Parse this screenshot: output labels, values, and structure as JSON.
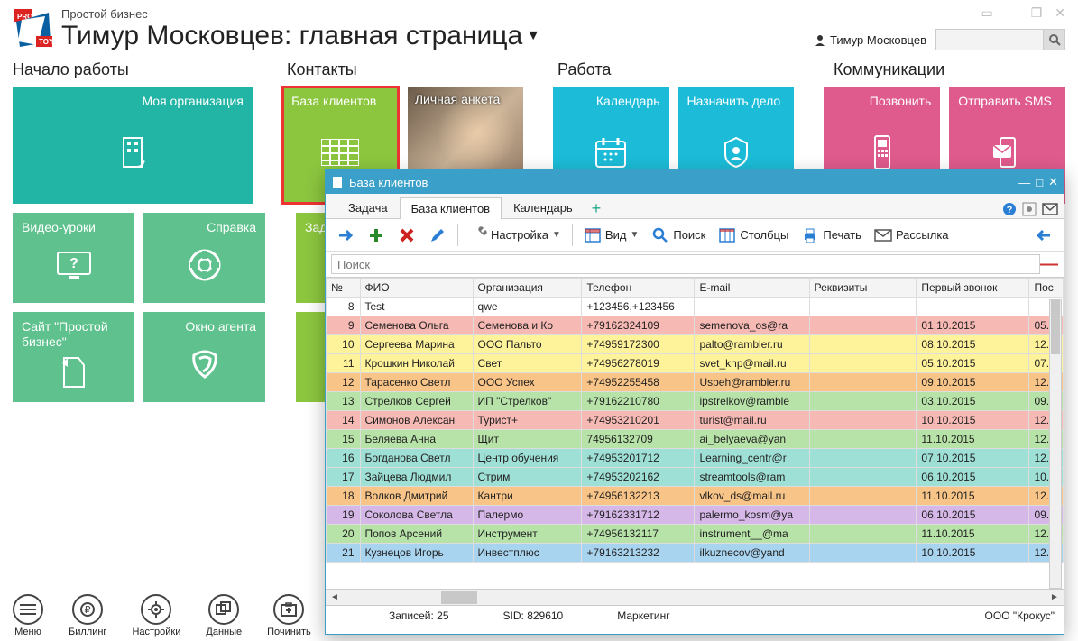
{
  "app": {
    "name": "Простой бизнес",
    "title": "Тимур Московцев: главная страница"
  },
  "user": {
    "name": "Тимур Московцев"
  },
  "search_placeholder": "",
  "sections": {
    "s1": "Начало работы",
    "s2": "Контакты",
    "s3": "Работа",
    "s4": "Коммуникации"
  },
  "tiles": {
    "my_org": "Моя организация",
    "baza": "База клиентов",
    "anketa": "Личная анкета",
    "calendar": "Календарь",
    "assign": "Назначить дело",
    "call": "Позвонить",
    "sms": "Отправить SMS",
    "video": "Видео-уроки",
    "help": "Справка",
    "zad": "Зад",
    "site": "Сайт \"Простой бизнес\"",
    "agent": "Окно агента"
  },
  "bottom": {
    "menu": "Меню",
    "billing": "Биллинг",
    "settings": "Настройки",
    "data": "Данные",
    "fix": "Починить"
  },
  "dbwin": {
    "title": "База клиентов",
    "tabs": {
      "task": "Задача",
      "baza": "База клиентов",
      "cal": "Календарь"
    },
    "toolbar": {
      "settings": "Настройка",
      "view": "Вид",
      "search": "Поиск",
      "columns": "Столбцы",
      "print": "Печать",
      "mail": "Рассылка"
    },
    "search_placeholder": "Поиск",
    "columns": {
      "num": "№",
      "fio": "ФИО",
      "org": "Организация",
      "tel": "Телефон",
      "email": "E-mail",
      "req": "Реквизиты",
      "first": "Первый звонок",
      "pos": "Пос"
    },
    "rows": [
      {
        "n": "8",
        "fio": "Test",
        "org": "qwe",
        "tel": "+123456,+123456",
        "email": "",
        "req": "",
        "first": "",
        "pos": "",
        "cls": "row-white"
      },
      {
        "n": "9",
        "fio": "Семенова Ольга",
        "org": "Семенова и Ко",
        "tel": "+79162324109",
        "email": "semenova_os@ra",
        "req": "",
        "first": "01.10.2015",
        "pos": "05.",
        "cls": "row-pink"
      },
      {
        "n": "10",
        "fio": "Сергеева Марина",
        "org": "ООО Пальто",
        "tel": "+74959172300",
        "email": "palto@rambler.ru",
        "req": "",
        "first": "08.10.2015",
        "pos": "12.",
        "cls": "row-yellow"
      },
      {
        "n": "11",
        "fio": "Крошкин Николай",
        "org": "Свет",
        "tel": "+74956278019",
        "email": "svet_knp@mail.ru",
        "req": "",
        "first": "05.10.2015",
        "pos": "07.",
        "cls": "row-yellow"
      },
      {
        "n": "12",
        "fio": "Тарасенко Светл",
        "org": "ООО Успех",
        "tel": "+74952255458",
        "email": "Uspeh@rambler.ru",
        "req": "",
        "first": "09.10.2015",
        "pos": "12.",
        "cls": "row-orange"
      },
      {
        "n": "13",
        "fio": "Стрелков Сергей",
        "org": "ИП \"Стрелков\"",
        "tel": "+79162210780",
        "email": "ipstrelkov@ramble",
        "req": "",
        "first": "03.10.2015",
        "pos": "09.",
        "cls": "row-green"
      },
      {
        "n": "14",
        "fio": "Симонов Алексан",
        "org": "Турист+",
        "tel": "+74953210201",
        "email": "turist@mail.ru",
        "req": "",
        "first": "10.10.2015",
        "pos": "12.",
        "cls": "row-pink"
      },
      {
        "n": "15",
        "fio": "Беляева Анна",
        "org": "Щит",
        "tel": "74956132709",
        "email": "ai_belyaeva@yan",
        "req": "",
        "first": "11.10.2015",
        "pos": "12.",
        "cls": "row-green"
      },
      {
        "n": "16",
        "fio": "Богданова Светл",
        "org": "Центр обучения",
        "tel": "+74953201712",
        "email": "Learning_centr@r",
        "req": "",
        "first": "07.10.2015",
        "pos": "12.",
        "cls": "row-teal"
      },
      {
        "n": "17",
        "fio": "Зайцева Людмил",
        "org": "Стрим",
        "tel": "+74953202162",
        "email": "streamtools@ram",
        "req": "",
        "first": "06.10.2015",
        "pos": "10.",
        "cls": "row-teal"
      },
      {
        "n": "18",
        "fio": "Волков Дмитрий",
        "org": "Кантри",
        "tel": "+74956132213",
        "email": "vlkov_ds@mail.ru",
        "req": "",
        "first": "11.10.2015",
        "pos": "12.",
        "cls": "row-orange"
      },
      {
        "n": "19",
        "fio": "Соколова Светла",
        "org": "Палермо",
        "tel": "+79162331712",
        "email": "palermo_kosm@ya",
        "req": "",
        "first": "06.10.2015",
        "pos": "09.",
        "cls": "row-purple"
      },
      {
        "n": "20",
        "fio": "Попов Арсений",
        "org": "Инструмент",
        "tel": "+74956132117",
        "email": "instrument__@ma",
        "req": "",
        "first": "11.10.2015",
        "pos": "12.",
        "cls": "row-green"
      },
      {
        "n": "21",
        "fio": "Кузнецов Игорь",
        "org": "Инвестплюс",
        "tel": "+79163213232",
        "email": "ilkuznecov@yand",
        "req": "",
        "first": "10.10.2015",
        "pos": "12.",
        "cls": "row-blue"
      }
    ],
    "status": {
      "records": "Записей: 25",
      "sid": "SID: 829610",
      "marketing": "Маркетинг",
      "org": "ООО \"Крокус\""
    }
  }
}
